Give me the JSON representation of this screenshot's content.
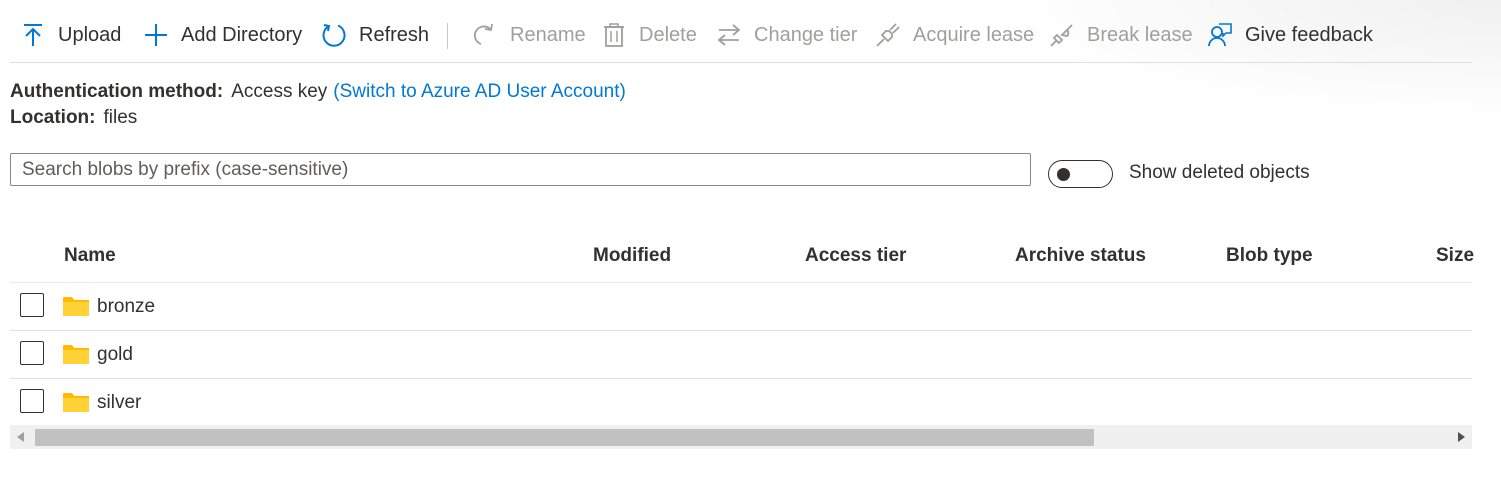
{
  "toolbar": {
    "upload": "Upload",
    "add_directory": "Add Directory",
    "refresh": "Refresh",
    "rename": "Rename",
    "delete": "Delete",
    "change_tier": "Change tier",
    "acquire_lease": "Acquire lease",
    "break_lease": "Break lease",
    "give_feedback": "Give feedback"
  },
  "info": {
    "auth_label": "Authentication method:",
    "auth_value": "Access key",
    "auth_switch_link": "(Switch to Azure AD User Account)",
    "location_label": "Location:",
    "location_value": "files"
  },
  "search": {
    "placeholder": "Search blobs by prefix (case-sensitive)",
    "value": ""
  },
  "deleted_toggle": {
    "label": "Show deleted objects",
    "on": false
  },
  "table": {
    "columns": [
      "Name",
      "Modified",
      "Access tier",
      "Archive status",
      "Blob type",
      "Size"
    ],
    "rows": [
      {
        "name": "bronze"
      },
      {
        "name": "gold"
      },
      {
        "name": "silver"
      }
    ]
  },
  "scrollbar": {
    "visible_fraction": 0.75
  },
  "colors": {
    "accent": "#0078d4",
    "text": "#323130",
    "disabled": "#a19f9d",
    "folder": "#ffb900"
  },
  "icons": {
    "upload": "upload-arrow-icon",
    "add_directory": "plus-icon",
    "refresh": "refresh-icon",
    "rename": "rename-icon",
    "delete": "trash-icon",
    "change_tier": "swap-arrows-icon",
    "acquire_lease": "plug-icon",
    "break_lease": "broken-plug-icon",
    "give_feedback": "feedback-person-icon",
    "folder": "folder-icon"
  }
}
